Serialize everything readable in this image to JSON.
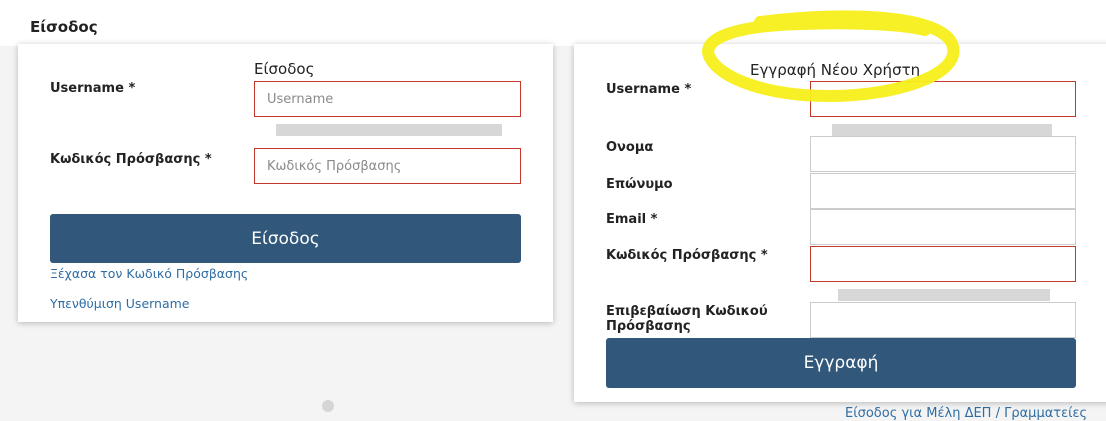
{
  "page": {
    "title": "Είσοδος"
  },
  "login": {
    "heading": "Είσοδος",
    "username_label": "Username *",
    "username_placeholder": "Username",
    "password_label": "Κωδικός Πρόσβασης *",
    "password_placeholder": "Κωδικός Πρόσβασης",
    "submit_label": "Είσοδος",
    "forgot_password_link": "Ξέχασα τον Κωδικό Πρόσβασης",
    "remind_username_link": "Υπενθύμιση Username"
  },
  "register": {
    "heading": "Εγγραφή Νέου Χρήστη",
    "username_label": "Username *",
    "first_name_label": "Ονομα",
    "last_name_label": "Επώνυμο",
    "email_label": "Email *",
    "password_label": "Κωδικός Πρόσβασης *",
    "confirm_password_label_line1": "Επιβεβαίωση Κωδικού",
    "confirm_password_label_line2": "Πρόσβασης",
    "submit_label": "Εγγραφή"
  },
  "footer": {
    "members_link": "Είσοδος για Μέλη ΔΕΠ / Γραμματείες"
  },
  "colors": {
    "button": "#31577a",
    "link": "#2e6da4",
    "error_border": "#c0392b",
    "highlight": "#f7ef1a"
  }
}
